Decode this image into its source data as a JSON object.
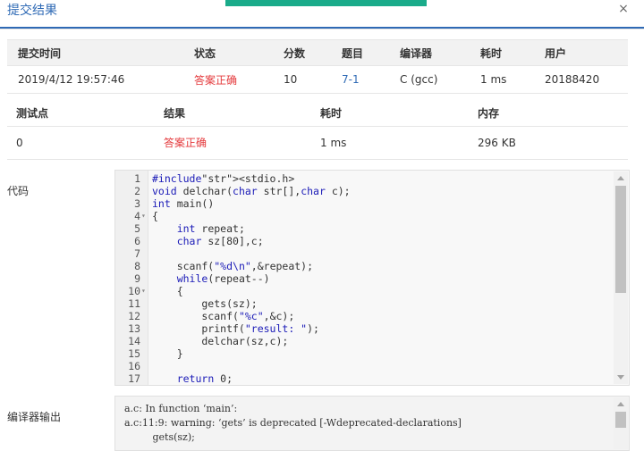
{
  "dialog": {
    "title": "提交结果",
    "close_icon": "×"
  },
  "submission": {
    "headers": [
      "提交时间",
      "状态",
      "分数",
      "题目",
      "编译器",
      "耗时",
      "用户"
    ],
    "row": {
      "time": "2019/4/12 19:57:46",
      "status": "答案正确",
      "score": "10",
      "problem": "7-1",
      "compiler": "C (gcc)",
      "duration": "1 ms",
      "user": "20188420"
    }
  },
  "testcases": {
    "headers": [
      "测试点",
      "结果",
      "耗时",
      "内存"
    ],
    "rows": [
      {
        "id": "0",
        "result": "答案正确",
        "duration": "1 ms",
        "memory": "296 KB"
      }
    ]
  },
  "code": {
    "label": "代码",
    "lines": [
      "#include<stdio.h>",
      "void delchar(char str[],char c);",
      "int main()",
      "{",
      "    int repeat;",
      "    char sz[80],c;",
      "",
      "    scanf(\"%d\\n\",&repeat);",
      "    while(repeat--)",
      "    {",
      "        gets(sz);",
      "        scanf(\"%c\",&c);",
      "        printf(\"result: \");",
      "        delchar(sz,c);",
      "    }",
      "",
      "    return 0;"
    ]
  },
  "compiler_output": {
    "label": "编译器输出",
    "lines": [
      "a.c: In function ‘main’:",
      "a.c:11:9: warning: ‘gets’ is deprecated [-Wdeprecated-declarations]",
      "         gets(sz);"
    ]
  },
  "colors": {
    "accent": "#2f6ab5",
    "success": "#e4393c",
    "top_bar": "#1aab8a"
  }
}
